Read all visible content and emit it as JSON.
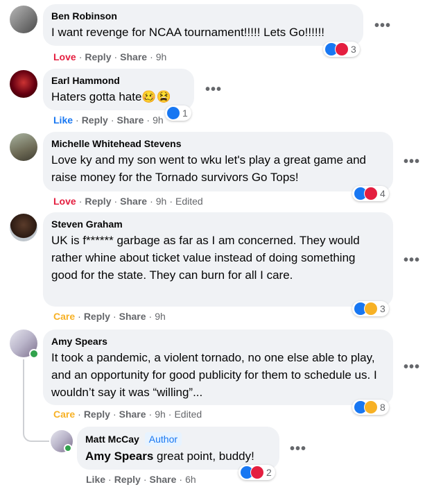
{
  "colors": {
    "love": "#e41e3f",
    "like": "#1877f2",
    "care": "#f7b125",
    "bubble": "#f0f2f5",
    "meta": "#65676b"
  },
  "labels": {
    "reply": "Reply",
    "share": "Share",
    "edited": "Edited",
    "sep": "·",
    "more": "•••"
  },
  "comments": [
    {
      "name": "Ben Robinson",
      "text": "I want revenge for NCAA tournament!!!!! Lets Go!!!!!!",
      "reaction_label": "Love",
      "time": "9h",
      "reaction_icons": [
        "like-icon",
        "love-icon"
      ],
      "reaction_count": "3"
    },
    {
      "name": "Earl Hammond",
      "text": "Haters gotta hate🥴😫",
      "reaction_label": "Like",
      "time": "9h",
      "reaction_icons": [
        "like-icon"
      ],
      "reaction_count": "1"
    },
    {
      "name": "Michelle Whitehead Stevens",
      "text": "Love ky and my son went to wku let's play a great game and raise money for the Tornado survivors Go Tops!",
      "reaction_label": "Love",
      "time": "9h",
      "edited": true,
      "reaction_icons": [
        "like-icon",
        "love-icon"
      ],
      "reaction_count": "4"
    },
    {
      "name": "Steven Graham",
      "text": "UK is f****** garbage as far as I am concerned. They would rather whine about ticket value instead of doing something good for the state. They can burn for all I care.",
      "reaction_label": "Care",
      "time": "9h",
      "reaction_icons": [
        "like-icon",
        "care-icon"
      ],
      "reaction_count": "3"
    },
    {
      "name": "Amy Spears",
      "text": "It took a pandemic, a violent tornado, no one else able to play, and an opportunity for good publicity for them to schedule us. I wouldn’t say it was “willing”...",
      "reaction_label": "Care",
      "time": "9h",
      "edited": true,
      "reaction_icons": [
        "like-icon",
        "care-icon"
      ],
      "reaction_count": "8"
    }
  ],
  "reply": {
    "name": "Matt McCay",
    "badge": "Author",
    "mention": "Amy Spears",
    "text": " great point, buddy!",
    "reaction_label": "Like",
    "time": "6h",
    "reaction_icons": [
      "like-icon",
      "love-icon"
    ],
    "reaction_count": "2"
  }
}
